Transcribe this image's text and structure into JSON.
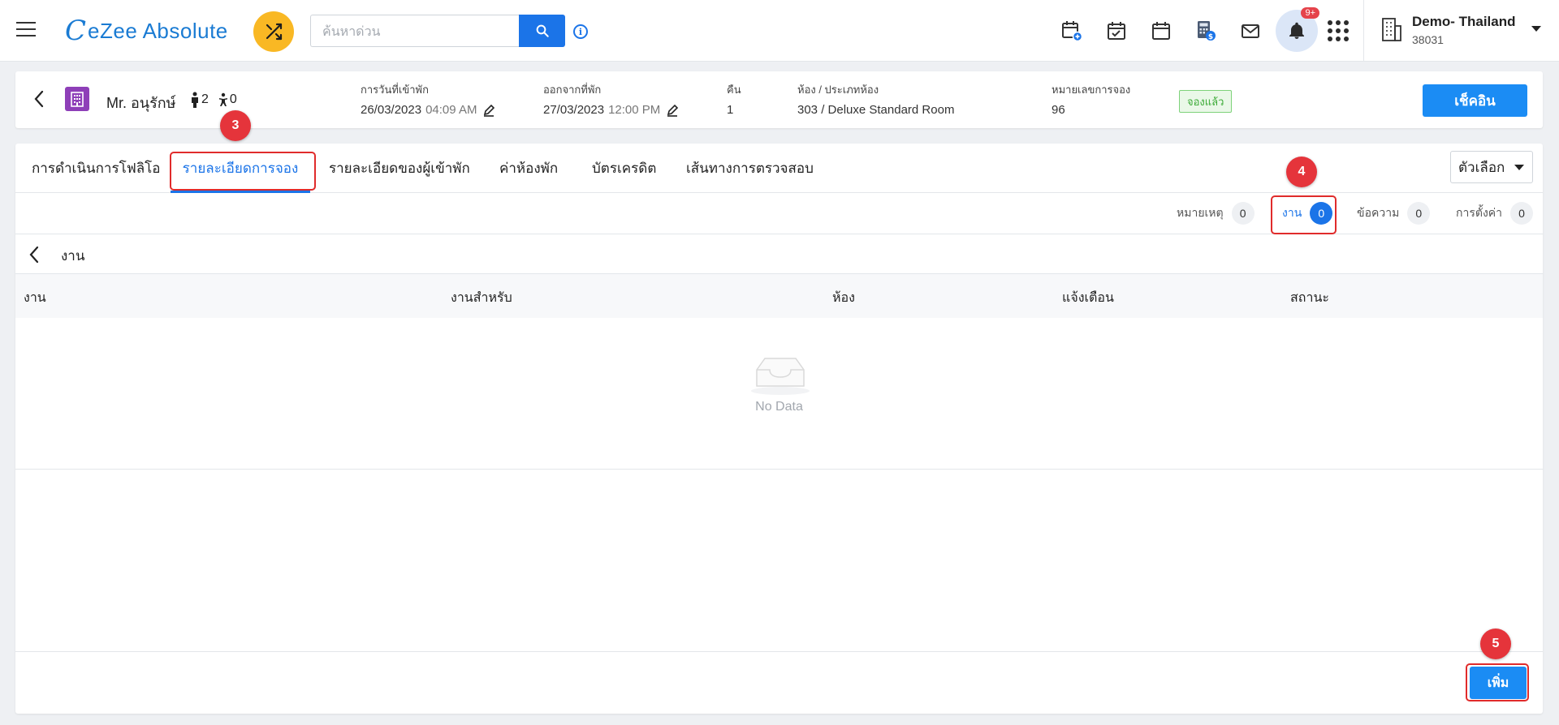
{
  "header": {
    "app_name": "eZee Absolute",
    "logo_mark": "C",
    "search_placeholder": "ค้นหาด่วน",
    "info_glyph": "i",
    "notification_badge": "9+",
    "hotel_name": "Demo- Thailand",
    "hotel_code": "38031",
    "icons": [
      "calendar-add-icon",
      "calendar-check-icon",
      "calendar-icon",
      "billing-calculator-icon",
      "mail-icon",
      "bell-icon",
      "apps-grid-icon",
      "building-icon"
    ]
  },
  "reservation": {
    "guest_name": "Mr. อนุรักษ์",
    "adults": "2",
    "children": "0",
    "checkin_label": "การวันที่เข้าพัก",
    "checkin_date": "26/03/2023",
    "checkin_time": "04:09 AM",
    "checkout_label": "ออกจากที่พัก",
    "checkout_date": "27/03/2023",
    "checkout_time": "12:00 PM",
    "nights_label": "คืน",
    "nights_value": "1",
    "room_label": "ห้อง / ประเภทห้อง",
    "room_value": "303 / Deluxe Standard Room",
    "res_no_label": "หมายเลขการจอง",
    "res_no_value": "96",
    "status": "จองแล้ว",
    "checkin_button": "เช็คอิน"
  },
  "tabs": [
    {
      "label": "การดำเนินการโฟลิโอ"
    },
    {
      "label": "รายละเอียดการจอง"
    },
    {
      "label": "รายละเอียดของผู้เข้าพัก"
    },
    {
      "label": "ค่าห้องพัก"
    },
    {
      "label": "บัตรเครดิต"
    },
    {
      "label": "เส้นทางการตรวจสอบ"
    }
  ],
  "options_button": "ตัวเลือก",
  "subtabs": [
    {
      "label": "หมายเหตุ",
      "count": "0"
    },
    {
      "label": "งาน",
      "count": "0"
    },
    {
      "label": "ข้อความ",
      "count": "0"
    },
    {
      "label": "การตั้งค่า",
      "count": "0"
    }
  ],
  "section": {
    "title": "งาน",
    "columns": [
      "งาน",
      "งานสำหรับ",
      "ห้อง",
      "แจ้งเตือน",
      "สถานะ"
    ],
    "empty_text": "No Data",
    "add_button": "เพิ่ม"
  },
  "annotations": [
    "3",
    "4",
    "5"
  ],
  "colors": {
    "primary": "#1b74e8",
    "button": "#1b8cf4",
    "accent_yellow": "#f9b824",
    "annotation_red": "#e5343b",
    "status_green": "#3aaa35"
  }
}
